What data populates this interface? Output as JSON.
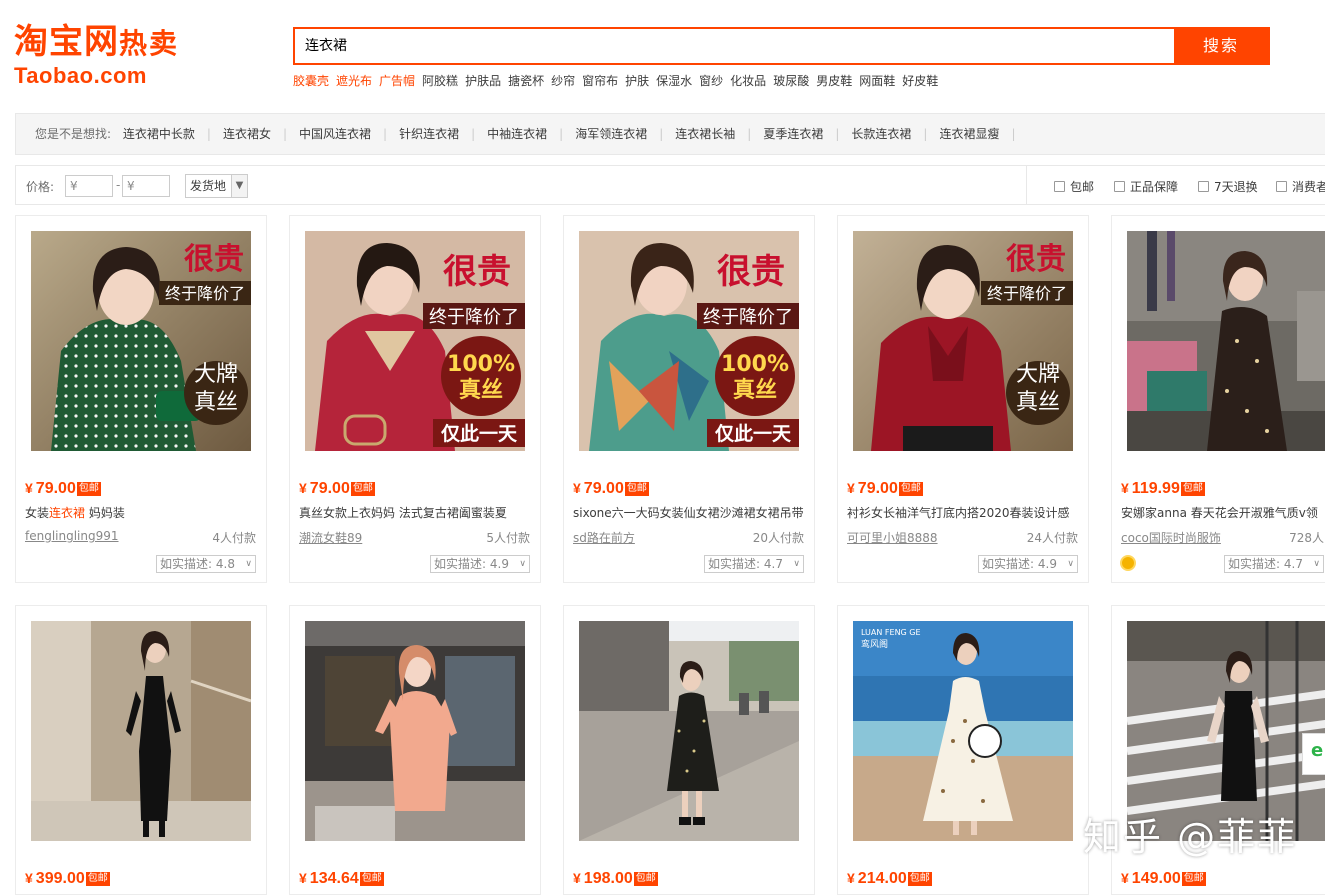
{
  "logo": {
    "cn": "淘宝网",
    "hot": "热卖",
    "en": "Taobao.com"
  },
  "search": {
    "value": "连衣裙",
    "button": "搜索"
  },
  "hotwords": [
    {
      "text": "胶囊壳",
      "red": true
    },
    {
      "text": "遮光布",
      "red": true
    },
    {
      "text": "广告帽",
      "red": true
    },
    {
      "text": "阿胶糕",
      "red": false
    },
    {
      "text": "护肤品",
      "red": false
    },
    {
      "text": "搪瓷杯",
      "red": false
    },
    {
      "text": "纱帘",
      "red": false
    },
    {
      "text": "窗帘布",
      "red": false
    },
    {
      "text": "护肤",
      "red": false
    },
    {
      "text": "保湿水",
      "red": false
    },
    {
      "text": "窗纱",
      "red": false
    },
    {
      "text": "化妆品",
      "red": false
    },
    {
      "text": "玻尿酸",
      "red": false
    },
    {
      "text": "男皮鞋",
      "red": false
    },
    {
      "text": "网面鞋",
      "red": false
    },
    {
      "text": "好皮鞋",
      "red": false
    }
  ],
  "suggest": {
    "prefix": "您是不是想找:",
    "keywords": [
      "连衣裙中长款",
      "连衣裙女",
      "中国风连衣裙",
      "针织连衣裙",
      "中袖连衣裙",
      "海军领连衣裙",
      "连衣裙长袖",
      "夏季连衣裙",
      "长款连衣裙",
      "连衣裙显瘦"
    ]
  },
  "filter": {
    "price_label": "价格:",
    "min_placeholder": "¥",
    "max_placeholder": "¥",
    "dash": "-",
    "location": "发货地",
    "checks": [
      "包邮",
      "正品保障",
      "7天退换",
      "消费者"
    ]
  },
  "free_label": "包邮",
  "products": [
    {
      "price": "79.00",
      "title_pre": "女装",
      "title_hl": "连衣裙",
      "title_post": " 妈妈装",
      "shop": "fenglingling991",
      "paid": "4人付款",
      "desc": "如实描述: 4.8",
      "badge": false
    },
    {
      "price": "79.00",
      "title_pre": "真丝女款上衣妈妈 法式复古裙阖蜜装夏",
      "title_hl": "",
      "title_post": "",
      "shop": "潮流女鞋89",
      "paid": "5人付款",
      "desc": "如实描述: 4.9",
      "badge": false
    },
    {
      "price": "79.00",
      "title_pre": "sixone六一大码女装仙女裙沙滩裙女裙吊带",
      "title_hl": "",
      "title_post": "",
      "shop": "sd路在前方",
      "paid": "20人付款",
      "desc": "如实描述: 4.7",
      "badge": false
    },
    {
      "price": "79.00",
      "title_pre": "衬衫女长袖洋气打底内搭2020春装设计感",
      "title_hl": "",
      "title_post": "",
      "shop": "可可里小姐8888",
      "paid": "24人付款",
      "desc": "如实描述: 4.9",
      "badge": false
    },
    {
      "price": "119.99",
      "title_pre": "安娜家anna 春天花会开淑雅气质v领",
      "title_hl": "",
      "title_post": "",
      "shop": "coco国际时尚服饰",
      "paid": "728人",
      "desc": "如实描述: 4.7",
      "badge": true
    },
    {
      "price": "399.00"
    },
    {
      "price": "134.64"
    },
    {
      "price": "198.00"
    },
    {
      "price": "214.00"
    },
    {
      "price": "149.00"
    }
  ],
  "promo": {
    "expensive": "很贵",
    "price_cut": "终于降价了",
    "brand1": "大牌",
    "brand2": "真丝",
    "silk_pct": "100%",
    "silk": "真丝",
    "one_day": "仅此一天"
  },
  "brand_tag": "LUAN FENG GE",
  "brand_tag_cn": "鸾风阁",
  "watermark": "知乎 @菲菲",
  "colors": {
    "accent": "#ff4400"
  }
}
